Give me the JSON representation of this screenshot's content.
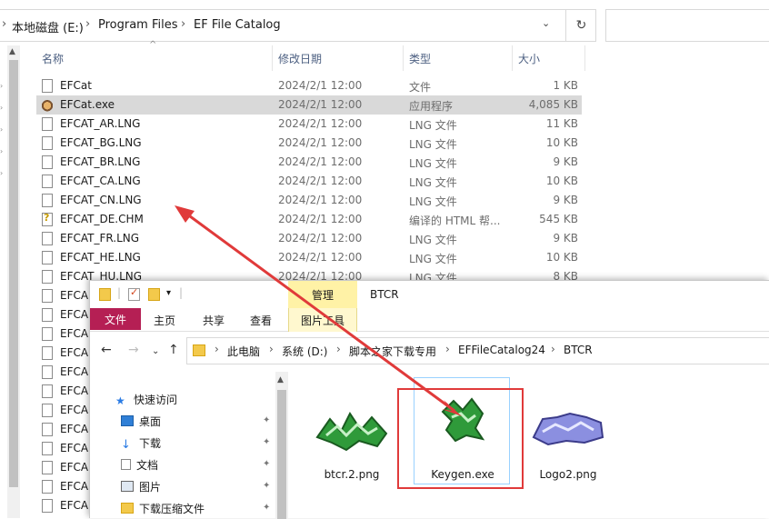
{
  "back_window": {
    "breadcrumb": [
      "本地磁盘 (E:)",
      "Program Files",
      "EF File Catalog"
    ],
    "columns": [
      "名称",
      "修改日期",
      "类型",
      "大小"
    ],
    "files": [
      {
        "name": "EFCat",
        "date": "2024/2/1 12:00",
        "type": "文件",
        "size": "1 KB",
        "icon": "file-icon"
      },
      {
        "name": "EFCat.exe",
        "date": "2024/2/1 12:00",
        "type": "应用程序",
        "size": "4,085 KB",
        "icon": "app-icon"
      },
      {
        "name": "EFCAT_AR.LNG",
        "date": "2024/2/1 12:00",
        "type": "LNG 文件",
        "size": "11 KB",
        "icon": "file-icon"
      },
      {
        "name": "EFCAT_BG.LNG",
        "date": "2024/2/1 12:00",
        "type": "LNG 文件",
        "size": "10 KB",
        "icon": "file-icon"
      },
      {
        "name": "EFCAT_BR.LNG",
        "date": "2024/2/1 12:00",
        "type": "LNG 文件",
        "size": "9 KB",
        "icon": "file-icon"
      },
      {
        "name": "EFCAT_CA.LNG",
        "date": "2024/2/1 12:00",
        "type": "LNG 文件",
        "size": "10 KB",
        "icon": "file-icon"
      },
      {
        "name": "EFCAT_CN.LNG",
        "date": "2024/2/1 12:00",
        "type": "LNG 文件",
        "size": "9 KB",
        "icon": "file-icon"
      },
      {
        "name": "EFCAT_DE.CHM",
        "date": "2024/2/1 12:00",
        "type": "编译的 HTML 帮...",
        "size": "545 KB",
        "icon": "chm-icon"
      },
      {
        "name": "EFCAT_FR.LNG",
        "date": "2024/2/1 12:00",
        "type": "LNG 文件",
        "size": "9 KB",
        "icon": "file-icon"
      },
      {
        "name": "EFCAT_HE.LNG",
        "date": "2024/2/1 12:00",
        "type": "LNG 文件",
        "size": "10 KB",
        "icon": "file-icon"
      },
      {
        "name": "EFCAT_HU.LNG",
        "date": "2024/2/1 12:00",
        "type": "LNG 文件",
        "size": "8 KB",
        "icon": "file-icon"
      }
    ],
    "partial_rows": [
      "EFCA",
      "EFCA",
      "EFCA",
      "EFCA",
      "EFCA",
      "EFCA",
      "EFCA",
      "EFCA",
      "EFCA",
      "EFCA",
      "EFCA",
      "EFCA"
    ]
  },
  "front_window": {
    "title": "BTCR",
    "manage_tab": "管理",
    "ribbon_tabs": [
      "文件",
      "主页",
      "共享",
      "查看",
      "图片工具"
    ],
    "breadcrumb": [
      "此电脑",
      "系统 (D:)",
      "脚本之家下载专用",
      "EFFileCatalog24",
      "BTCR"
    ],
    "nav_items": [
      {
        "label": "快速访问",
        "icon": "star-icon"
      },
      {
        "label": "桌面",
        "icon": "desktop-icon"
      },
      {
        "label": "下载",
        "icon": "download-icon"
      },
      {
        "label": "文档",
        "icon": "document-icon"
      },
      {
        "label": "图片",
        "icon": "pictures-icon"
      },
      {
        "label": "下载压缩文件",
        "icon": "folder-icon"
      }
    ],
    "thumbnails": [
      {
        "label": "btcr.2.png"
      },
      {
        "label": "Keygen.exe"
      },
      {
        "label": "Logo2.png"
      }
    ]
  },
  "colors": {
    "file_tab": "#b51f54",
    "manage_tab": "#fff2a6",
    "annotation_red": "#e03a3a",
    "selected_row": "#d9d9d9"
  }
}
